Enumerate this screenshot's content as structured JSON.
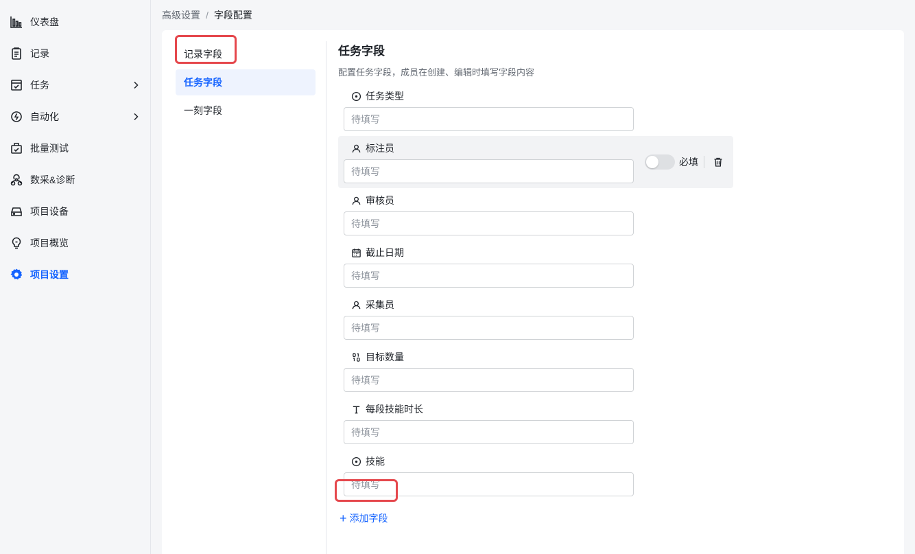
{
  "sidebar": {
    "items": [
      {
        "label": "仪表盘",
        "icon": "chart-bar-icon",
        "chevron": false,
        "active": false
      },
      {
        "label": "记录",
        "icon": "clipboard-icon",
        "chevron": false,
        "active": false
      },
      {
        "label": "任务",
        "icon": "task-box-icon",
        "chevron": true,
        "active": false
      },
      {
        "label": "自动化",
        "icon": "automation-icon",
        "chevron": true,
        "active": false
      },
      {
        "label": "批量测试",
        "icon": "batch-test-icon",
        "chevron": false,
        "active": false
      },
      {
        "label": "数采&诊断",
        "icon": "radiation-icon",
        "chevron": false,
        "active": false
      },
      {
        "label": "项目设备",
        "icon": "device-icon",
        "chevron": false,
        "active": false
      },
      {
        "label": "项目概览",
        "icon": "bulb-icon",
        "chevron": false,
        "active": false
      },
      {
        "label": "项目设置",
        "icon": "gear-icon",
        "chevron": false,
        "active": true
      }
    ]
  },
  "breadcrumb": {
    "parent": "高级设置",
    "separator": "/",
    "current": "字段配置"
  },
  "subnav": {
    "items": [
      {
        "label": "记录字段",
        "active": false
      },
      {
        "label": "任务字段",
        "active": true
      },
      {
        "label": "一刻字段",
        "active": false
      }
    ]
  },
  "content": {
    "title": "任务字段",
    "description": "配置任务字段，成员在创建、编辑时填写字段内容",
    "fields": [
      {
        "label": "任务类型",
        "icon": "radio-icon",
        "placeholder": "待填写"
      },
      {
        "label": "标注员",
        "icon": "user-icon",
        "placeholder": "待填写",
        "hover": true,
        "required_label": "必填",
        "required": false
      },
      {
        "label": "审核员",
        "icon": "user-icon",
        "placeholder": "待填写"
      },
      {
        "label": "截止日期",
        "icon": "calendar-icon",
        "placeholder": "待填写"
      },
      {
        "label": "采集员",
        "icon": "user-icon",
        "placeholder": "待填写"
      },
      {
        "label": "目标数量",
        "icon": "number-icon",
        "placeholder": "待填写"
      },
      {
        "label": "每段技能时长",
        "icon": "text-icon",
        "placeholder": "待填写"
      },
      {
        "label": "技能",
        "icon": "radio-icon",
        "placeholder": "待填写"
      }
    ],
    "add_field_label": "添加字段"
  },
  "colors": {
    "accent": "#1664ff",
    "highlight": "#e5484d"
  }
}
